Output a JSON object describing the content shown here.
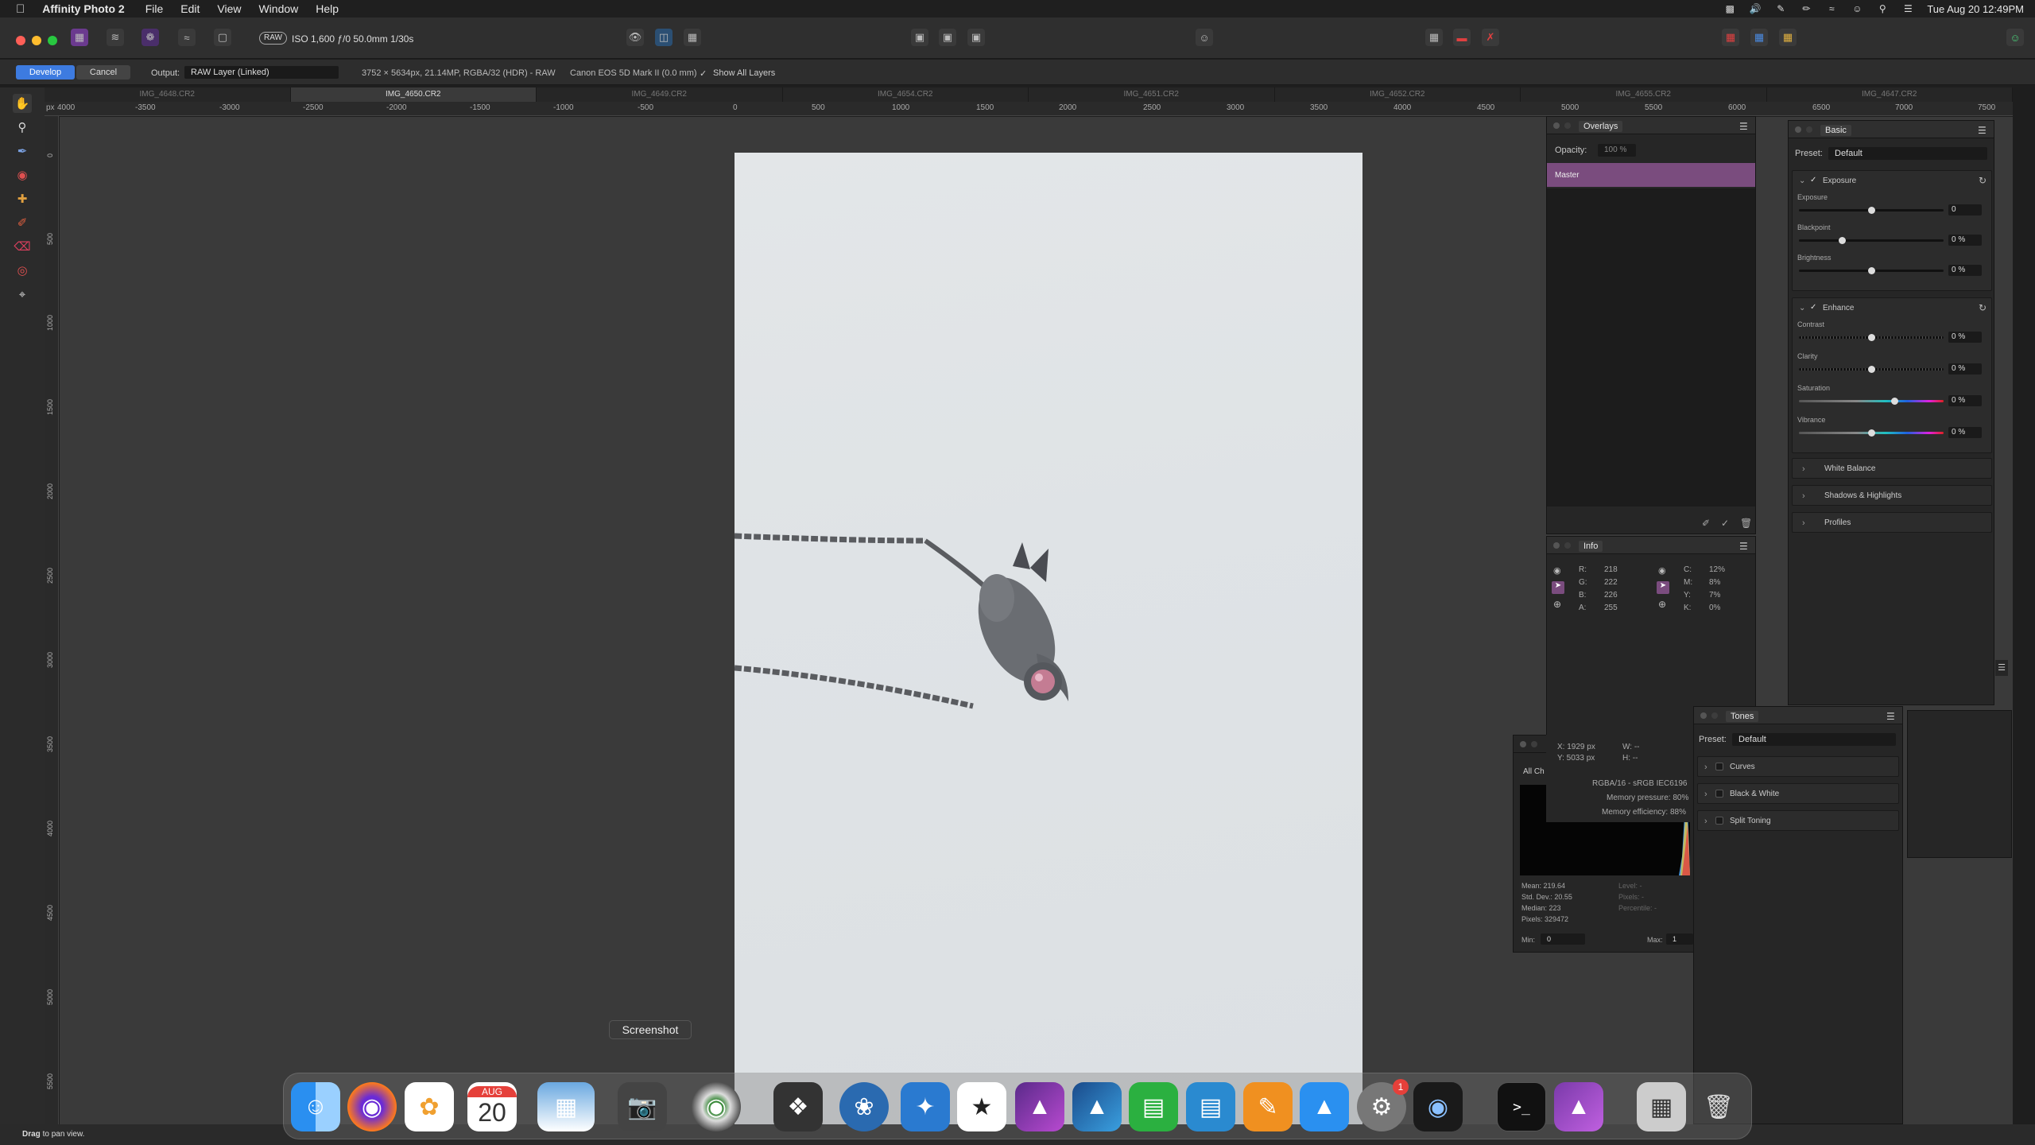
{
  "menubar": {
    "app_name": "Affinity Photo 2",
    "items": [
      "File",
      "Edit",
      "View",
      "Window",
      "Help"
    ],
    "clock": "Tue Aug 20  12:49PM"
  },
  "toolbar": {
    "raw_badge": "RAW",
    "exif": "ISO 1,600 ƒ/0 50.0mm 1/30s"
  },
  "context": {
    "develop_label": "Develop",
    "cancel_label": "Cancel",
    "output_label": "Output:",
    "output_value": "RAW Layer (Linked)",
    "image_info": "3752 × 5634px, 21.14MP, RGBA/32 (HDR) - RAW",
    "camera": "Canon EOS 5D Mark II (0.0 mm)",
    "show_all_layers": "Show All Layers"
  },
  "tabs": [
    "IMG_4648.CR2",
    "IMG_4650.CR2",
    "IMG_4649.CR2",
    "IMG_4654.CR2",
    "IMG_4651.CR2",
    "IMG_4652.CR2",
    "IMG_4655.CR2",
    "IMG_4647.CR2"
  ],
  "active_tab_index": 1,
  "ruler": {
    "unit": "px",
    "h_labels": [
      "4000",
      "-3500",
      "-3000",
      "-2500",
      "-2000",
      "-1500",
      "-1000",
      "-500",
      "0",
      "500",
      "1000",
      "1500",
      "2000",
      "2500",
      "3000",
      "3500",
      "4000",
      "4500",
      "5000",
      "5500",
      "6000",
      "6500",
      "7000",
      "7500"
    ],
    "v_labels": [
      "0",
      "500",
      "1000",
      "1500",
      "2000",
      "2500",
      "3000",
      "3500",
      "4000",
      "4500",
      "5000",
      "5500"
    ]
  },
  "overlays": {
    "title": "Overlays",
    "opacity_label": "Opacity:",
    "opacity_value": "100 %",
    "master_label": "Master"
  },
  "info": {
    "title": "Info",
    "rgb": [
      {
        "k": "R:",
        "v": "218"
      },
      {
        "k": "G:",
        "v": "222"
      },
      {
        "k": "B:",
        "v": "226"
      },
      {
        "k": "A:",
        "v": "255"
      }
    ],
    "cmyk": [
      {
        "k": "C:",
        "v": "12%"
      },
      {
        "k": "M:",
        "v": "8%"
      },
      {
        "k": "Y:",
        "v": "7%"
      },
      {
        "k": "K:",
        "v": "0%"
      }
    ],
    "x": "X: 1929 px",
    "y": "Y: 5033 px",
    "w": "W: --",
    "h": "H: --",
    "color_profile": "RGBA/16 - sRGB IEC6196",
    "memory_pressure": "Memory pressure: 80%",
    "memory_efficiency": "Memory efficiency: 88%"
  },
  "histogram": {
    "channel": "All Ch",
    "mean": "Mean: 219.64",
    "std": "Std. Dev.: 20.55",
    "median": "Median: 223",
    "pixels": "Pixels: 329472",
    "level": "Level: -",
    "pixels_r": "Pixels: -",
    "percentile": "Percentile: -",
    "min_label": "Min:",
    "min_value": "0",
    "max_label": "Max:",
    "max_value": "1"
  },
  "basic": {
    "title": "Basic",
    "preset_label": "Preset:",
    "preset_value": "Default",
    "exposure_section": "Exposure",
    "sliders1": [
      {
        "label": "Exposure",
        "value": "0"
      },
      {
        "label": "Blackpoint",
        "value": "0 %"
      },
      {
        "label": "Brightness",
        "value": "0 %"
      }
    ],
    "enhance_section": "Enhance",
    "sliders2": [
      {
        "label": "Contrast",
        "value": "0 %"
      },
      {
        "label": "Clarity",
        "value": "0 %"
      },
      {
        "label": "Saturation",
        "value": "0 %"
      },
      {
        "label": "Vibrance",
        "value": "0 %"
      }
    ],
    "collapsed": [
      "White Balance",
      "Shadows & Highlights",
      "Profiles"
    ]
  },
  "tones": {
    "title": "Tones",
    "preset_label": "Preset:",
    "preset_value": "Default",
    "sections": [
      "Curves",
      "Black & White",
      "Split Toning"
    ]
  },
  "dock": {
    "tooltip": "Screenshot",
    "calendar_month": "AUG",
    "calendar_day": "20",
    "badge": "1"
  },
  "status": {
    "hint_bold": "Drag",
    "hint": " to pan view."
  }
}
